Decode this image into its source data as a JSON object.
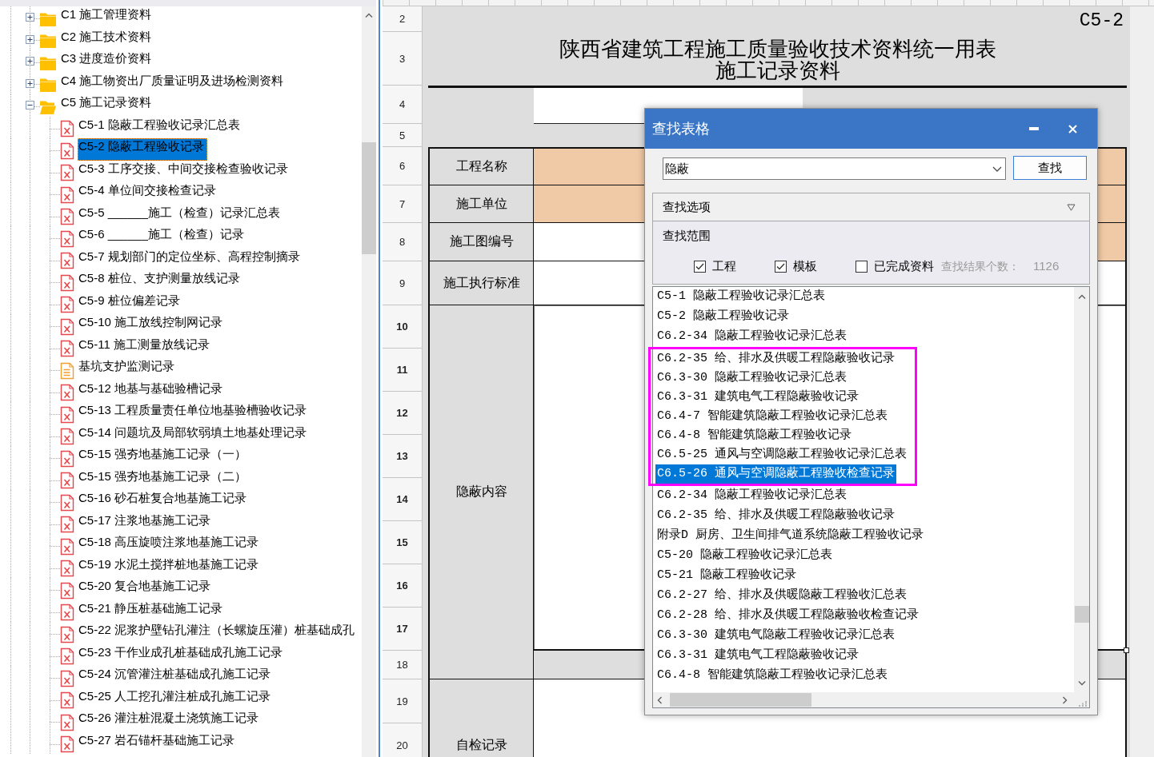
{
  "tree": {
    "items": [
      {
        "label": "C1 施工管理资料",
        "kind": "folder",
        "expanded": false,
        "selected": false
      },
      {
        "label": "C2 施工技术资料",
        "kind": "folder",
        "expanded": false,
        "selected": false
      },
      {
        "label": "C3 进度造价资料",
        "kind": "folder",
        "expanded": false,
        "selected": false
      },
      {
        "label": "C4 施工物资出厂质量证明及进场检测资料",
        "kind": "folder",
        "expanded": false,
        "selected": false
      },
      {
        "label": "C5 施工记录资料",
        "kind": "folder",
        "expanded": true,
        "selected": false,
        "children": [
          {
            "label": "C5-1 隐蔽工程验收记录汇总表",
            "kind": "form",
            "selected": false
          },
          {
            "label": "C5-2 隐蔽工程验收记录",
            "kind": "form",
            "selected": true
          },
          {
            "label": "C5-3 工序交接、中间交接检查验收记录",
            "kind": "form",
            "selected": false
          },
          {
            "label": "C5-4 单位间交接检查记录",
            "kind": "form",
            "selected": false
          },
          {
            "label": "C5-5 ______施工（检查）记录汇总表",
            "kind": "form",
            "selected": false
          },
          {
            "label": "C5-6 ______施工（检查）记录",
            "kind": "form",
            "selected": false
          },
          {
            "label": "C5-7 规划部门的定位坐标、高程控制摘录",
            "kind": "form",
            "selected": false
          },
          {
            "label": "C5-8 桩位、支护测量放线记录",
            "kind": "form",
            "selected": false
          },
          {
            "label": "C5-9 桩位偏差记录",
            "kind": "form",
            "selected": false
          },
          {
            "label": "C5-10 施工放线控制网记录",
            "kind": "form",
            "selected": false
          },
          {
            "label": "C5-11 施工测量放线记录",
            "kind": "form",
            "selected": false
          },
          {
            "label": "基坑支护监测记录",
            "kind": "document",
            "selected": false
          },
          {
            "label": "C5-12 地基与基础验槽记录",
            "kind": "form",
            "selected": false
          },
          {
            "label": "C5-13 工程质量责任单位地基验槽验收记录",
            "kind": "form",
            "selected": false
          },
          {
            "label": "C5-14 问题坑及局部软弱填土地基处理记录",
            "kind": "form",
            "selected": false
          },
          {
            "label": "C5-15 强夯地基施工记录（一）",
            "kind": "form",
            "selected": false
          },
          {
            "label": "C5-15 强夯地基施工记录（二）",
            "kind": "form",
            "selected": false
          },
          {
            "label": "C5-16 砂石桩复合地基施工记录",
            "kind": "form",
            "selected": false
          },
          {
            "label": "C5-17 注浆地基施工记录",
            "kind": "form",
            "selected": false
          },
          {
            "label": "C5-18 高压旋喷注浆地基施工记录",
            "kind": "form",
            "selected": false
          },
          {
            "label": "C5-19 水泥土搅拌桩地基施工记录",
            "kind": "form",
            "selected": false
          },
          {
            "label": "C5-20 复合地基施工记录",
            "kind": "form",
            "selected": false
          },
          {
            "label": "C5-21 静压桩基础施工记录",
            "kind": "form",
            "selected": false
          },
          {
            "label": "C5-22 泥浆护壁钻孔灌注（长螺旋压灌）桩基础成孔",
            "kind": "form",
            "selected": false
          },
          {
            "label": "C5-23 干作业成孔桩基础成孔施工记录",
            "kind": "form",
            "selected": false
          },
          {
            "label": "C5-24 沉管灌注桩基础成孔施工记录",
            "kind": "form",
            "selected": false
          },
          {
            "label": "C5-25 人工挖孔灌注桩成孔施工记录",
            "kind": "form",
            "selected": false
          },
          {
            "label": "C5-26 灌注桩混凝土浇筑施工记录",
            "kind": "form",
            "selected": false
          },
          {
            "label": "C5-27 岩石锚杆基础施工记录",
            "kind": "form",
            "selected": false
          }
        ]
      }
    ]
  },
  "sheet": {
    "form_code": "C5-2",
    "title_lines": [
      "陕西省建筑工程施工质量验收技术资料统一用表",
      "施工记录资料"
    ],
    "rows": [
      {
        "number": "2",
        "selected": false
      },
      {
        "number": "3",
        "selected": false
      },
      {
        "number": "4",
        "selected": false
      },
      {
        "number": "5",
        "selected": false
      },
      {
        "number": "6",
        "selected": false
      },
      {
        "number": "7",
        "selected": false
      },
      {
        "number": "8",
        "selected": false
      },
      {
        "number": "9",
        "selected": false
      },
      {
        "number": "10",
        "selected": true
      },
      {
        "number": "11",
        "selected": true
      },
      {
        "number": "12",
        "selected": true
      },
      {
        "number": "13",
        "selected": true
      },
      {
        "number": "14",
        "selected": true
      },
      {
        "number": "15",
        "selected": true
      },
      {
        "number": "16",
        "selected": true
      },
      {
        "number": "17",
        "selected": true
      },
      {
        "number": "18",
        "selected": false
      },
      {
        "number": "19",
        "selected": false
      },
      {
        "number": "20",
        "selected": false
      }
    ],
    "fields": [
      {
        "label": "工程名称",
        "cells": [
          {
            "highlighted": true,
            "selected": false
          },
          {
            "highlighted": true,
            "selected": false
          }
        ]
      },
      {
        "label": "施工单位",
        "cells": [
          {
            "highlighted": true,
            "selected": false
          },
          {
            "highlighted": true,
            "selected": false
          }
        ]
      },
      {
        "label": "施工图编号",
        "cells": [
          {
            "highlighted": false,
            "selected": false
          },
          {
            "highlighted": true,
            "selected": false
          }
        ]
      },
      {
        "label": "施工执行标准",
        "cells": [
          {
            "highlighted": false,
            "selected": false
          },
          {
            "highlighted": false,
            "selected": false
          }
        ]
      },
      {
        "label": "隐蔽内容",
        "cells": [
          {
            "highlighted": false,
            "selected": true
          },
          {
            "highlighted": false,
            "selected": true
          }
        ]
      },
      {
        "label": "自检记录",
        "cells": [
          {
            "highlighted": false,
            "selected": false
          }
        ]
      }
    ]
  },
  "dialog": {
    "title": "查找表格",
    "search": {
      "value": "隐蔽"
    },
    "search_button": "查找",
    "options": {
      "label": "查找选项",
      "expanded": true,
      "scope_label": "查找范围",
      "scope": [
        {
          "label": "工程",
          "checked": true
        },
        {
          "label": "模板",
          "checked": true
        },
        {
          "label": "已完成资料",
          "checked": false
        }
      ],
      "count_label": "查找结果个数：",
      "count": "1126"
    },
    "results": [
      {
        "framed": false,
        "items": [
          {
            "label": "C5-1 隐蔽工程验收记录汇总表",
            "selected": false
          },
          {
            "label": "C5-2 隐蔽工程验收记录",
            "selected": false
          },
          {
            "label": "C6.2-34 隐蔽工程验收记录汇总表",
            "selected": false
          }
        ]
      },
      {
        "framed": true,
        "items": [
          {
            "label": "C6.2-35 给、排水及供暖工程隐蔽验收记录",
            "selected": false
          },
          {
            "label": "C6.3-30 隐蔽工程验收记录汇总表",
            "selected": false
          },
          {
            "label": "C6.3-31 建筑电气工程隐蔽验收记录",
            "selected": false
          },
          {
            "label": "C6.4-7 智能建筑隐蔽工程验收记录汇总表",
            "selected": false
          },
          {
            "label": "C6.4-8 智能建筑隐蔽工程验收记录",
            "selected": false
          },
          {
            "label": "C6.5-25 通风与空调隐蔽工程验收记录汇总表",
            "selected": false
          },
          {
            "label": "C6.5-26 通风与空调隐蔽工程验收检查记录",
            "selected": true
          }
        ]
      },
      {
        "framed": false,
        "items": [
          {
            "label": "C6.2-34 隐蔽工程验收记录汇总表",
            "selected": false
          },
          {
            "label": "C6.2-35 给、排水及供暖工程隐蔽验收记录",
            "selected": false
          },
          {
            "label": "附录D 厨房、卫生间排气道系统隐蔽工程验收记录",
            "selected": false
          },
          {
            "label": "C5-20 隐蔽工程验收记录汇总表",
            "selected": false
          },
          {
            "label": "C5-21 隐蔽工程验收记录",
            "selected": false
          },
          {
            "label": "C6.2-27 给、排水及供暖隐蔽工程验收汇总表",
            "selected": false
          },
          {
            "label": "C6.2-28 给、排水及供暖工程隐蔽验收检查记录",
            "selected": false
          },
          {
            "label": "C6.3-30 建筑电气隐蔽工程验收记录汇总表",
            "selected": false
          },
          {
            "label": "C6.3-31 建筑电气工程隐蔽验收记录",
            "selected": false
          },
          {
            "label": "C6.4-8 智能建筑隐蔽工程验收记录汇总表",
            "selected": false
          }
        ]
      }
    ]
  }
}
